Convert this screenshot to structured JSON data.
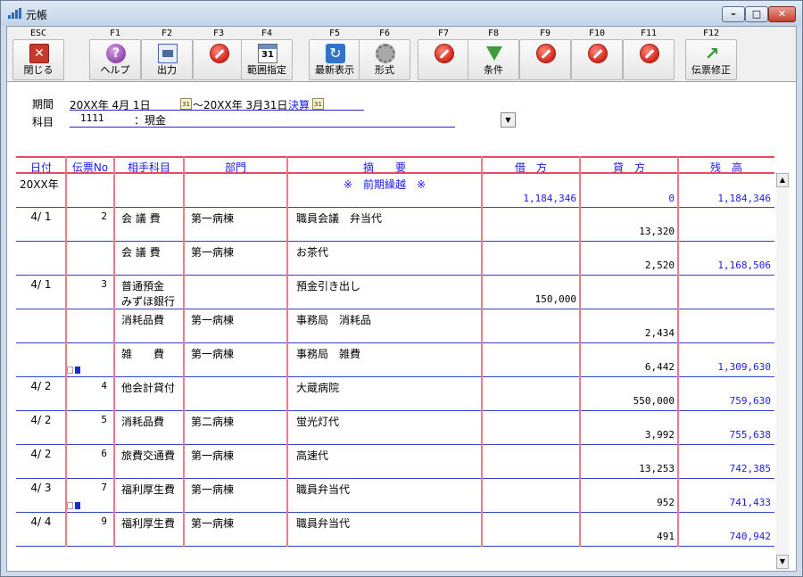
{
  "window": {
    "title": "元帳"
  },
  "toolbar": {
    "buttons": [
      {
        "key": "ESC",
        "label": "閉じる",
        "icon": "close-icon"
      },
      {
        "key": "F1",
        "label": "ヘルプ",
        "icon": "help-icon"
      },
      {
        "key": "F2",
        "label": "出力",
        "icon": "print-icon"
      },
      {
        "key": "F3",
        "label": "",
        "icon": "disabled-icon"
      },
      {
        "key": "F4",
        "label": "範囲指定",
        "icon": "calendar-icon"
      },
      {
        "key": "F5",
        "label": "最新表示",
        "icon": "refresh-icon"
      },
      {
        "key": "F6",
        "label": "形式",
        "icon": "gear-icon"
      },
      {
        "key": "F7",
        "label": "",
        "icon": "disabled-icon"
      },
      {
        "key": "F8",
        "label": "条件",
        "icon": "filter-icon"
      },
      {
        "key": "F9",
        "label": "",
        "icon": "disabled-icon"
      },
      {
        "key": "F10",
        "label": "",
        "icon": "disabled-icon"
      },
      {
        "key": "F11",
        "label": "",
        "icon": "disabled-icon"
      },
      {
        "key": "F12",
        "label": "伝票修正",
        "icon": "arrow-icon"
      }
    ],
    "calendar_day": "31"
  },
  "filter": {
    "period_label": "期間",
    "period_from": "20XX年  4月 1日",
    "period_to": "～20XX年  3月31日",
    "settlement": "決算",
    "subject_label": "科目",
    "subject_code": "1111",
    "subject_name": "：現金",
    "cal_glyph": "31"
  },
  "table": {
    "headers": [
      "日付",
      "伝票No",
      "相手科目",
      "部門",
      "摘　　要",
      "借　方",
      "貸　方",
      "残　高"
    ],
    "rows": [
      {
        "date": "20XX年",
        "no": "",
        "account": "",
        "account2": "",
        "dept": "",
        "desc": "※　前期繰越　※",
        "desc_center": true,
        "debit": "1,184,346",
        "credit": "0",
        "balance": "1,184,346",
        "amount_color": "blue",
        "mark": false
      },
      {
        "date": "4/ 1",
        "no": "2",
        "account": "会 議 費",
        "account2": "",
        "dept": "第一病棟",
        "desc": "職員会議　弁当代",
        "debit": "",
        "credit": "13,320",
        "balance": "",
        "mark": false
      },
      {
        "date": "",
        "no": "",
        "account": "会 議 費",
        "account2": "",
        "dept": "第一病棟",
        "desc": "お茶代",
        "debit": "",
        "credit": "2,520",
        "balance": "1,168,506",
        "mark": false
      },
      {
        "date": "4/ 1",
        "no": "3",
        "account": "普通預金",
        "account2": "みずほ銀行",
        "dept": "",
        "desc": "預金引き出し",
        "debit": "150,000",
        "credit": "",
        "balance": "",
        "mark": false,
        "debit_mid": true
      },
      {
        "date": "",
        "no": "",
        "account": "消耗品費",
        "account2": "",
        "dept": "第一病棟",
        "desc": "事務局　消耗品",
        "debit": "",
        "credit": "2,434",
        "balance": "",
        "mark": false
      },
      {
        "date": "",
        "no": "",
        "account": "雑　　費",
        "account2": "",
        "dept": "第一病棟",
        "desc": "事務局　雑費",
        "debit": "",
        "credit": "6,442",
        "balance": "1,309,630",
        "mark": true
      },
      {
        "date": "4/ 2",
        "no": "4",
        "account": "他会計貸付",
        "account2": "",
        "dept": "",
        "desc": "大蔵病院",
        "debit": "",
        "credit": "550,000",
        "balance": "759,630",
        "mark": false
      },
      {
        "date": "4/ 2",
        "no": "5",
        "account": "消耗品費",
        "account2": "",
        "dept": "第二病棟",
        "desc": "蛍光灯代",
        "debit": "",
        "credit": "3,992",
        "balance": "755,638",
        "mark": false
      },
      {
        "date": "4/ 2",
        "no": "6",
        "account": "旅費交通費",
        "account2": "",
        "dept": "第一病棟",
        "desc": "高速代",
        "debit": "",
        "credit": "13,253",
        "balance": "742,385",
        "mark": false
      },
      {
        "date": "4/ 3",
        "no": "7",
        "account": "福利厚生費",
        "account2": "",
        "dept": "第一病棟",
        "desc": "職員弁当代",
        "debit": "",
        "credit": "952",
        "balance": "741,433",
        "mark": true
      },
      {
        "date": "4/ 4",
        "no": "9",
        "account": "福利厚生費",
        "account2": "",
        "dept": "第一病棟",
        "desc": "職員弁当代",
        "debit": "",
        "credit": "491",
        "balance": "740,942",
        "mark": false
      }
    ]
  },
  "colors": {
    "header_text": "#1a1aff",
    "grid_red": "#e84a5f",
    "row_line": "#3344cc",
    "balance_text": "#1a1aff"
  }
}
